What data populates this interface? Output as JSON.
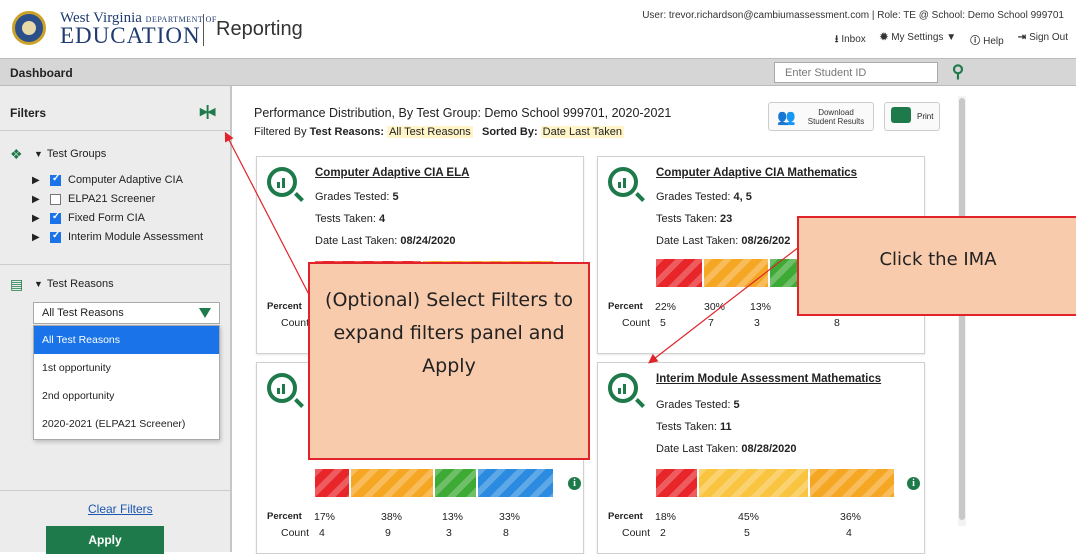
{
  "header": {
    "brand_top": "West Virginia",
    "brand_dept": "DEPARTMENT OF",
    "brand_main": "EDUCATION",
    "app_title": "Reporting",
    "user_line": "User: trevor.richardson@cambiumassessment.com  |  Role: TE @ School: Demo School 999701",
    "links": {
      "inbox": "Inbox",
      "settings": "My Settings ▼",
      "help": "Help",
      "signout": "Sign Out"
    }
  },
  "dashbar": {
    "title": "Dashboard",
    "student_placeholder": "Enter Student ID"
  },
  "sidebar": {
    "filters_label": "Filters",
    "test_groups_label": "Test Groups",
    "test_groups": [
      {
        "label": "Computer Adaptive CIA",
        "checked": true
      },
      {
        "label": "ELPA21 Screener",
        "checked": false
      },
      {
        "label": "Fixed Form CIA",
        "checked": true
      },
      {
        "label": "Interim Module Assessment",
        "checked": true
      }
    ],
    "test_reasons_label": "Test Reasons",
    "selected_reason": "All Test Reasons",
    "reason_options": [
      "All Test Reasons",
      "1st opportunity",
      "2nd opportunity",
      "2020-2021 (ELPA21 Screener)"
    ],
    "clear_filters": "Clear Filters",
    "apply": "Apply"
  },
  "main": {
    "title": "Performance Distribution, By Test Group: Demo School 999701, 2020-2021",
    "filtered_by_label": "Filtered By",
    "test_reasons_label": "Test Reasons:",
    "test_reasons_value": "All Test Reasons",
    "sorted_by_label": "Sorted By:",
    "sorted_by_value": "Date Last Taken",
    "download_label_1": "Download",
    "download_label_2": "Student Results",
    "print_label": "Print"
  },
  "cards": [
    {
      "title": "Computer Adaptive CIA ELA",
      "grades_label": "Grades Tested:",
      "grades": "5",
      "tests_label": "Tests Taken:",
      "tests": "4",
      "date_label": "Date Last Taken:",
      "date": "08/24/2020",
      "percents": [
        "",
        "",
        "",
        ""
      ],
      "counts": [
        "",
        "",
        "",
        ""
      ]
    },
    {
      "title": "Computer Adaptive CIA Mathematics",
      "grades_label": "Grades Tested:",
      "grades": "4, 5",
      "tests_label": "Tests Taken:",
      "tests": "23",
      "date_label": "Date Last Taken:",
      "date": "08/26/202",
      "percents": [
        "22%",
        "30%",
        "13%",
        ""
      ],
      "counts": [
        "5",
        "7",
        "3",
        "8"
      ]
    },
    {
      "title": "",
      "percents": [
        "17%",
        "38%",
        "13%",
        "33%"
      ],
      "counts": [
        "4",
        "9",
        "3",
        "8"
      ]
    },
    {
      "title": "Interim Module Assessment Mathematics",
      "grades_label": "Grades Tested:",
      "grades": "5",
      "tests_label": "Tests Taken:",
      "tests": "11",
      "date_label": "Date Last Taken:",
      "date": "08/28/2020",
      "percents": [
        "18%",
        "45%",
        "36%"
      ],
      "counts": [
        "2",
        "5",
        "4"
      ]
    }
  ],
  "row_labels": {
    "percent": "Percent",
    "count": "Count"
  },
  "level_colors": {
    "red": "#e8262a",
    "orange": "#f5a623",
    "green": "#3daa35",
    "blue": "#2a8be0",
    "light_orange": "#f9c440"
  },
  "callouts": {
    "optional": "(Optional) Select Filters to expand filters panel and Apply",
    "ima": "Click the IMA"
  }
}
